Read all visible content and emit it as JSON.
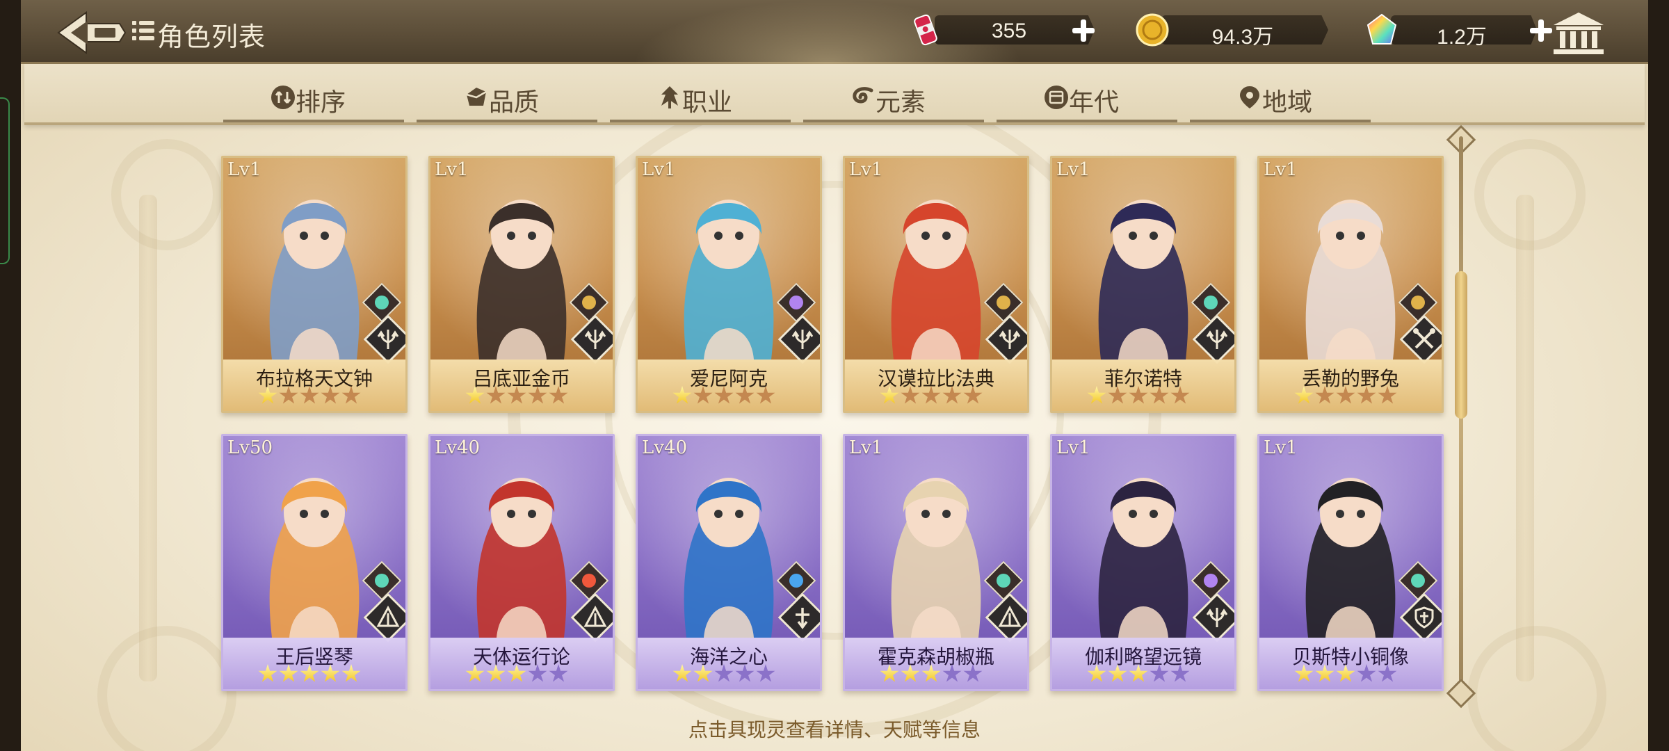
{
  "header": {
    "title": "角色列表",
    "resources": [
      {
        "name": "stamina",
        "icon": "drink-can-icon",
        "value": "355"
      },
      {
        "name": "gold",
        "icon": "gold-coin-icon",
        "value": "94.3万"
      },
      {
        "name": "gems",
        "icon": "rainbow-crystal-icon",
        "value": "1.2万"
      }
    ]
  },
  "filters": [
    {
      "label": "排序",
      "icon": "sort-icon"
    },
    {
      "label": "品质",
      "icon": "gem-quality-icon"
    },
    {
      "label": "职业",
      "icon": "class-icon"
    },
    {
      "label": "元素",
      "icon": "element-swirl-icon"
    },
    {
      "label": "年代",
      "icon": "calendar-icon"
    },
    {
      "label": "地域",
      "icon": "location-pin-icon"
    }
  ],
  "cards": [
    {
      "level": "Lv1",
      "name": "布拉格天文钟",
      "rarity": "gold",
      "stars": 1,
      "max_stars": 5,
      "element": "wind",
      "job": "trident",
      "art_hue": "#7f9dc6"
    },
    {
      "level": "Lv1",
      "name": "吕底亚金币",
      "rarity": "gold",
      "stars": 1,
      "max_stars": 5,
      "element": "earth",
      "job": "trident",
      "art_hue": "#3b2f2a"
    },
    {
      "level": "Lv1",
      "name": "爱尼阿克",
      "rarity": "gold",
      "stars": 1,
      "max_stars": 5,
      "element": "thunder",
      "job": "trident",
      "art_hue": "#4fb0d4"
    },
    {
      "level": "Lv1",
      "name": "汉谟拉比法典",
      "rarity": "gold",
      "stars": 1,
      "max_stars": 5,
      "element": "earth",
      "job": "trident",
      "art_hue": "#d6452c"
    },
    {
      "level": "Lv1",
      "name": "菲尔诺特",
      "rarity": "gold",
      "stars": 1,
      "max_stars": 5,
      "element": "wind",
      "job": "trident",
      "art_hue": "#2e2a57"
    },
    {
      "level": "Lv1",
      "name": "丢勒的野兔",
      "rarity": "gold",
      "stars": 1,
      "max_stars": 5,
      "element": "earth",
      "job": "crossed-tools",
      "art_hue": "#e9dcd6"
    },
    {
      "level": "Lv50",
      "name": "王后竖琴",
      "rarity": "purple",
      "stars": 5,
      "max_stars": 5,
      "element": "wind",
      "job": "tome",
      "art_hue": "#f0a24a"
    },
    {
      "level": "Lv40",
      "name": "天体运行论",
      "rarity": "purple",
      "stars": 3,
      "max_stars": 5,
      "element": "fire",
      "job": "tome",
      "art_hue": "#c2352c"
    },
    {
      "level": "Lv40",
      "name": "海洋之心",
      "rarity": "purple",
      "stars": 2,
      "max_stars": 5,
      "element": "water",
      "job": "cross",
      "art_hue": "#2f74c8"
    },
    {
      "level": "Lv1",
      "name": "霍克森胡椒瓶",
      "rarity": "purple",
      "stars": 3,
      "max_stars": 5,
      "element": "wind",
      "job": "tome",
      "art_hue": "#e7d3b0"
    },
    {
      "level": "Lv1",
      "name": "伽利略望远镜",
      "rarity": "purple",
      "stars": 3,
      "max_stars": 5,
      "element": "thunder",
      "job": "trident",
      "art_hue": "#2c2340"
    },
    {
      "level": "Lv1",
      "name": "贝斯特小铜像",
      "rarity": "purple",
      "stars": 3,
      "max_stars": 5,
      "element": "wind",
      "job": "shield",
      "art_hue": "#222124"
    }
  ],
  "element_colors": {
    "wind": "#5ed6b8",
    "earth": "#e0b24a",
    "thunder": "#b184f0",
    "fire": "#f0583c",
    "water": "#4aa6f0"
  },
  "hint": "点击具现灵查看详情、天赋等信息",
  "scroll": {
    "position": 0.33
  }
}
